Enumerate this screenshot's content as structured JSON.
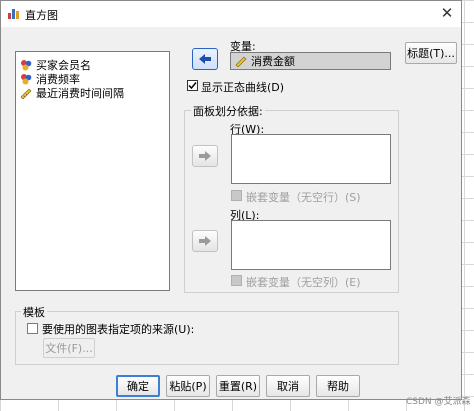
{
  "window": {
    "title": "直方图",
    "close_symbol": "✕"
  },
  "variables": [
    {
      "label": "买家会员名",
      "icon": "nominal-variable-icon"
    },
    {
      "label": "消费频率",
      "icon": "nominal-variable-icon"
    },
    {
      "label": "最近消费时间间隔",
      "icon": "scale-variable-icon"
    }
  ],
  "variable_field": {
    "label": "变量:",
    "value": "消费金额"
  },
  "normal_curve": {
    "label": "显示正态曲线(D)",
    "checked": true
  },
  "panel_group": {
    "title": "面板划分依据:",
    "rows_label": "行(W):",
    "rows_nest_label": "嵌套变量（无空行）(S)",
    "cols_label": "列(L):",
    "cols_nest_label": "嵌套变量（无空列）(E)"
  },
  "template_group": {
    "title": "模板",
    "use_label": "要使用的图表指定项的来源(U):",
    "file_button": "文件(F)..."
  },
  "buttons": {
    "titles": "标题(T)...",
    "ok": "确定",
    "paste": "粘贴(P)",
    "reset": "重置(R)",
    "cancel": "取消",
    "help": "帮助"
  },
  "watermark": "CSDN @艾派森",
  "colors": {
    "accent": "#3c7fd6",
    "dialog_bg": "#f0f0f0"
  }
}
